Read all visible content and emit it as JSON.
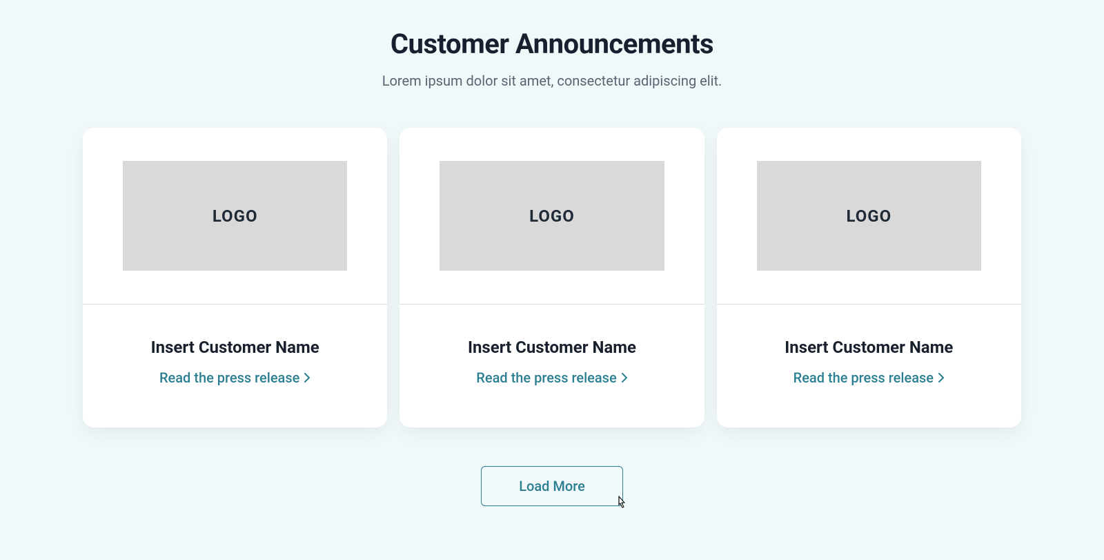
{
  "header": {
    "title": "Customer Announcements",
    "subtitle": "Lorem ipsum dolor sit amet, consectetur adipiscing elit."
  },
  "cards": [
    {
      "logo_text": "LOGO",
      "name": "Insert Customer Name",
      "link_text": "Read the press release"
    },
    {
      "logo_text": "LOGO",
      "name": "Insert Customer Name",
      "link_text": "Read the press release"
    },
    {
      "logo_text": "LOGO",
      "name": "Insert Customer Name",
      "link_text": "Read the press release"
    }
  ],
  "actions": {
    "load_more": "Load More"
  },
  "colors": {
    "accent": "#2b7f91",
    "bg": "#f0f8f9",
    "card_bg": "#ffffff",
    "logo_placeholder": "#d9d9d9",
    "text_dark": "#16202f",
    "text_muted": "#5a6472"
  }
}
